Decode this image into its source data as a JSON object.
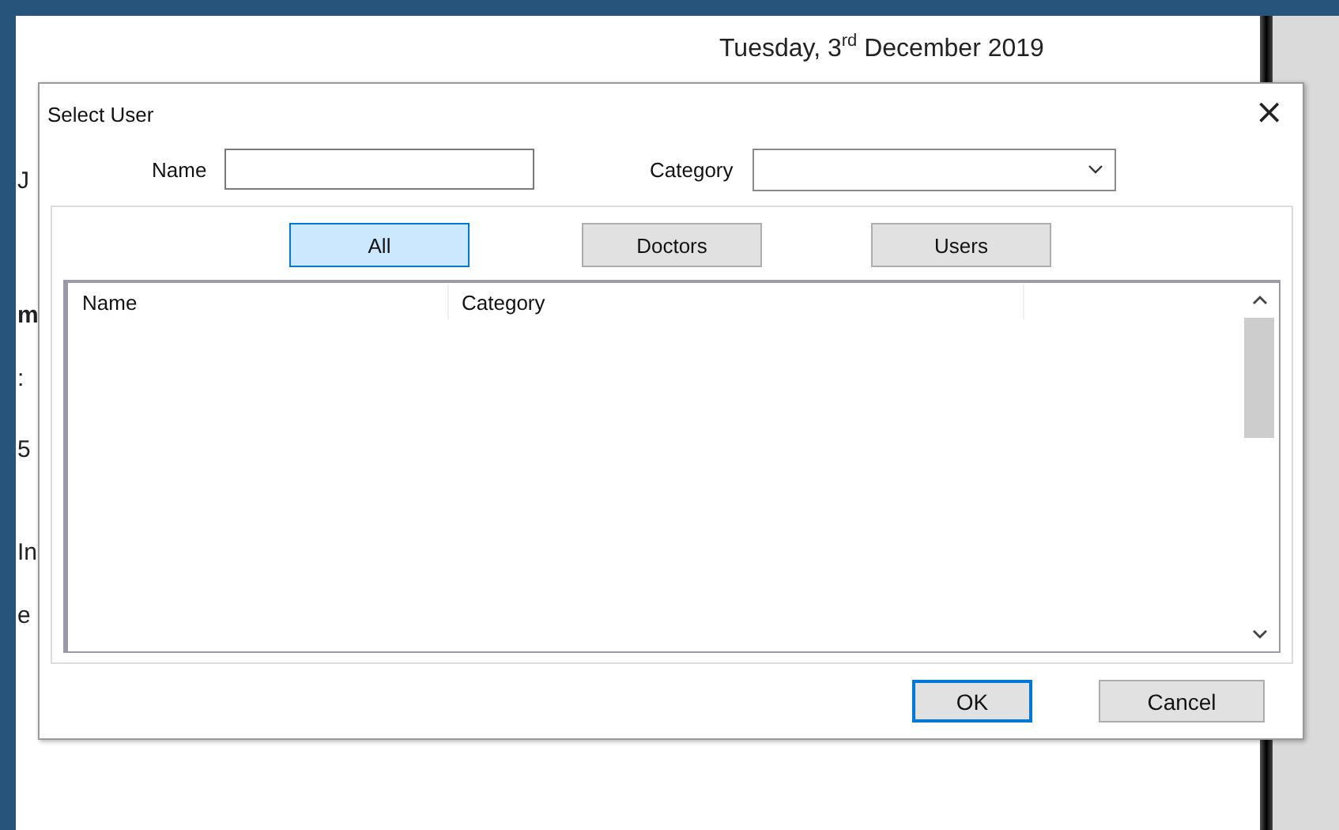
{
  "page": {
    "date": "Tuesday, 3$^{rd}$ December 2019",
    "fragments": [
      "J",
      "m",
      ":",
      "5",
      "In",
      "e"
    ]
  },
  "dialog": {
    "title": "Select User",
    "close": "×",
    "name_field": {
      "label": "Name"
    },
    "category_field": {
      "label": "Category"
    },
    "filters": [
      {
        "label": "All",
        "selected": true
      },
      {
        "label": "Doctors",
        "selected": false
      },
      {
        "label": "Users",
        "selected": false
      }
    ],
    "list": {
      "columns": [
        "Name",
        "Category"
      ]
    },
    "buttons": [
      {
        "label": "OK",
        "default": true
      },
      {
        "label": "Cancel",
        "default": false
      }
    ]
  }
}
